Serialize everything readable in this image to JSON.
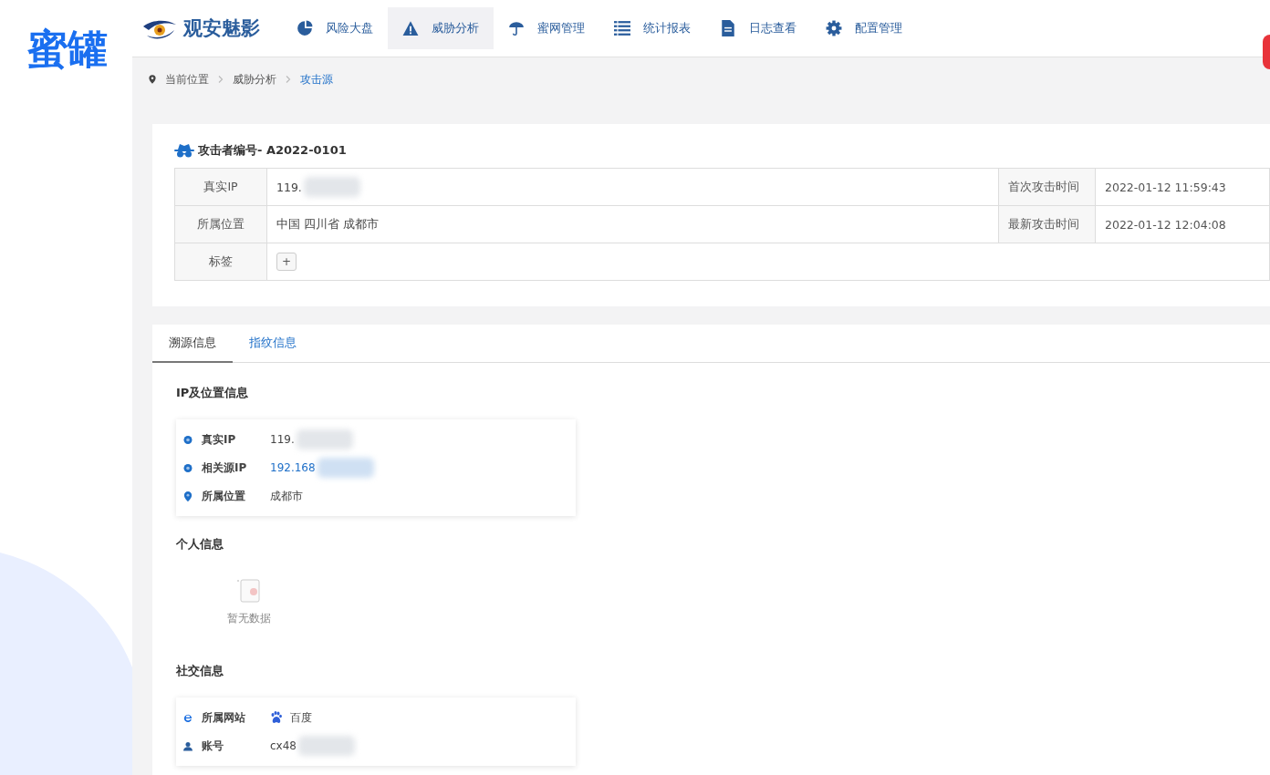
{
  "side_title": "蜜罐",
  "brand": "观安魅影",
  "nav": [
    {
      "label": "风险大盘",
      "kind": "pie",
      "selected": false
    },
    {
      "label": "威胁分析",
      "kind": "warning",
      "selected": true
    },
    {
      "label": "蜜网管理",
      "kind": "umbrella",
      "selected": false
    },
    {
      "label": "统计报表",
      "kind": "list",
      "selected": false
    },
    {
      "label": "日志查看",
      "kind": "file",
      "selected": false
    },
    {
      "label": "配置管理",
      "kind": "gear",
      "selected": false
    }
  ],
  "breadcrumb": [
    {
      "label": "当前位置",
      "selected": false
    },
    {
      "label": "威胁分析",
      "selected": false
    },
    {
      "label": "攻击源",
      "selected": true
    }
  ],
  "attacker_title": "攻击者编号- A2022-0101",
  "info_rows": [
    {
      "kind": "text",
      "label": "真实IP",
      "value": "119.",
      "redacted": true,
      "label_2": "首次攻击时间",
      "value_2": "2022-01-12 11:59:43"
    },
    {
      "kind": "text",
      "label": "所属位置",
      "value": "中国 四川省 成都市",
      "redacted": false,
      "label_2": "最新攻击时间",
      "value_2": "2022-01-12 12:04:08"
    },
    {
      "kind": "tags",
      "label": "标签",
      "button": "+"
    }
  ],
  "tabs": [
    {
      "label": "溯源信息",
      "selected": true
    },
    {
      "label": "指纹信息",
      "selected": false
    }
  ],
  "sections": [
    {
      "title": "IP及位置信息",
      "kind": "list",
      "items": [
        {
          "kind": "dot",
          "label": "真实IP",
          "value": "119.",
          "redacted": true,
          "link": false,
          "logo": false
        },
        {
          "kind": "dot",
          "label": "相关源IP",
          "value": "192.168",
          "redacted": true,
          "link": true,
          "logo": false
        },
        {
          "kind": "pin",
          "label": "所属位置",
          "value": "成都市",
          "redacted": false,
          "link": false,
          "logo": false
        }
      ]
    },
    {
      "title": "个人信息",
      "kind": "empty",
      "empty_text": "暂无数据"
    },
    {
      "title": "社交信息",
      "kind": "list",
      "items": [
        {
          "kind": "ie",
          "label": "所属网站",
          "value": "百度",
          "logo": true,
          "redacted": false,
          "link": false
        },
        {
          "kind": "user",
          "label": "账号",
          "value": "cx48",
          "logo": false,
          "redacted": true,
          "link": false
        }
      ]
    }
  ]
}
